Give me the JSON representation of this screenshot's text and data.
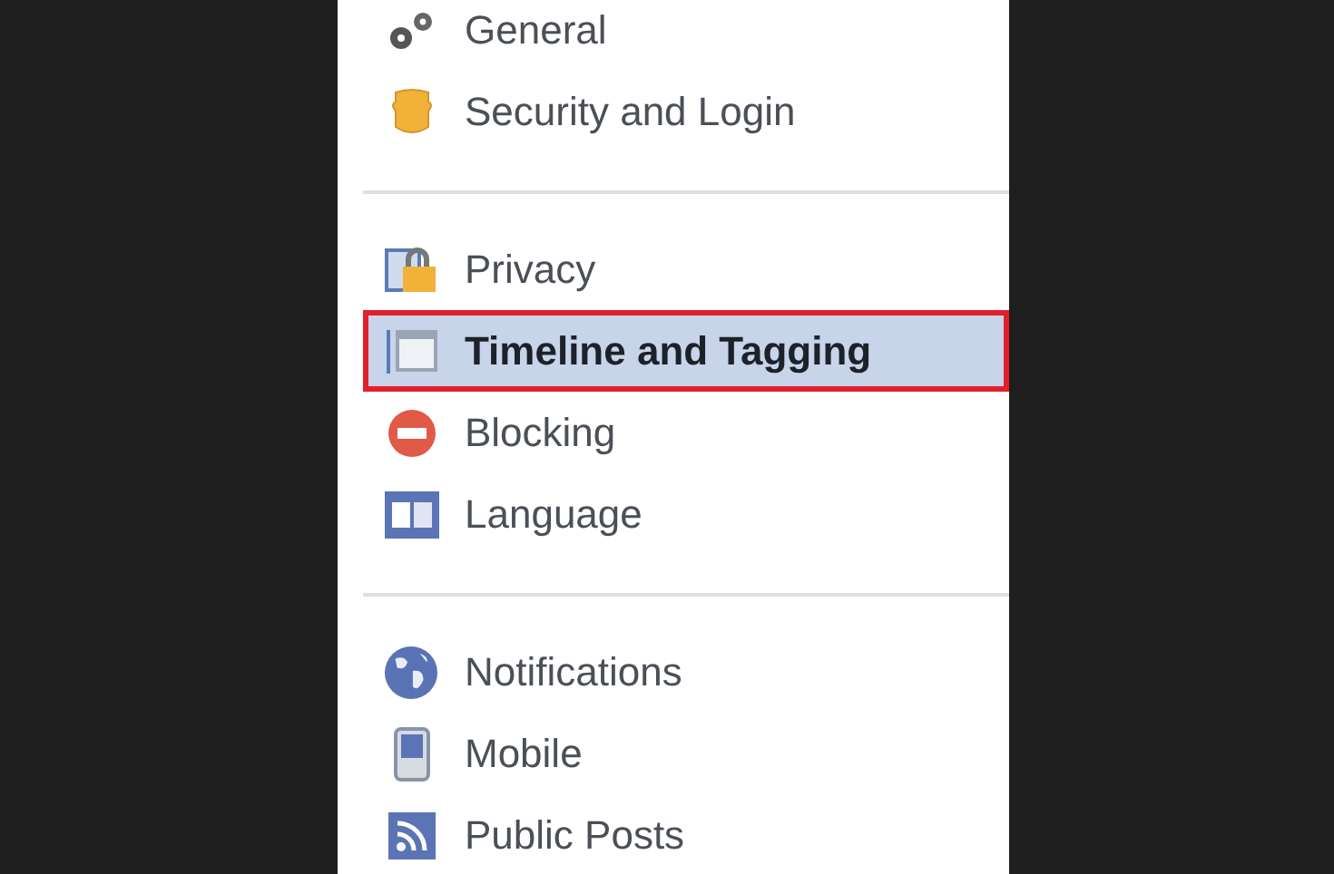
{
  "sections": [
    {
      "items": [
        {
          "label": "General",
          "selected": false
        },
        {
          "label": "Security and Login",
          "selected": false
        }
      ]
    },
    {
      "items": [
        {
          "label": "Privacy",
          "selected": false
        },
        {
          "label": "Timeline and Tagging",
          "selected": true
        },
        {
          "label": "Blocking",
          "selected": false
        },
        {
          "label": "Language",
          "selected": false
        }
      ]
    },
    {
      "items": [
        {
          "label": "Notifications",
          "selected": false
        },
        {
          "label": "Mobile",
          "selected": false
        },
        {
          "label": "Public Posts",
          "selected": false
        }
      ]
    }
  ]
}
